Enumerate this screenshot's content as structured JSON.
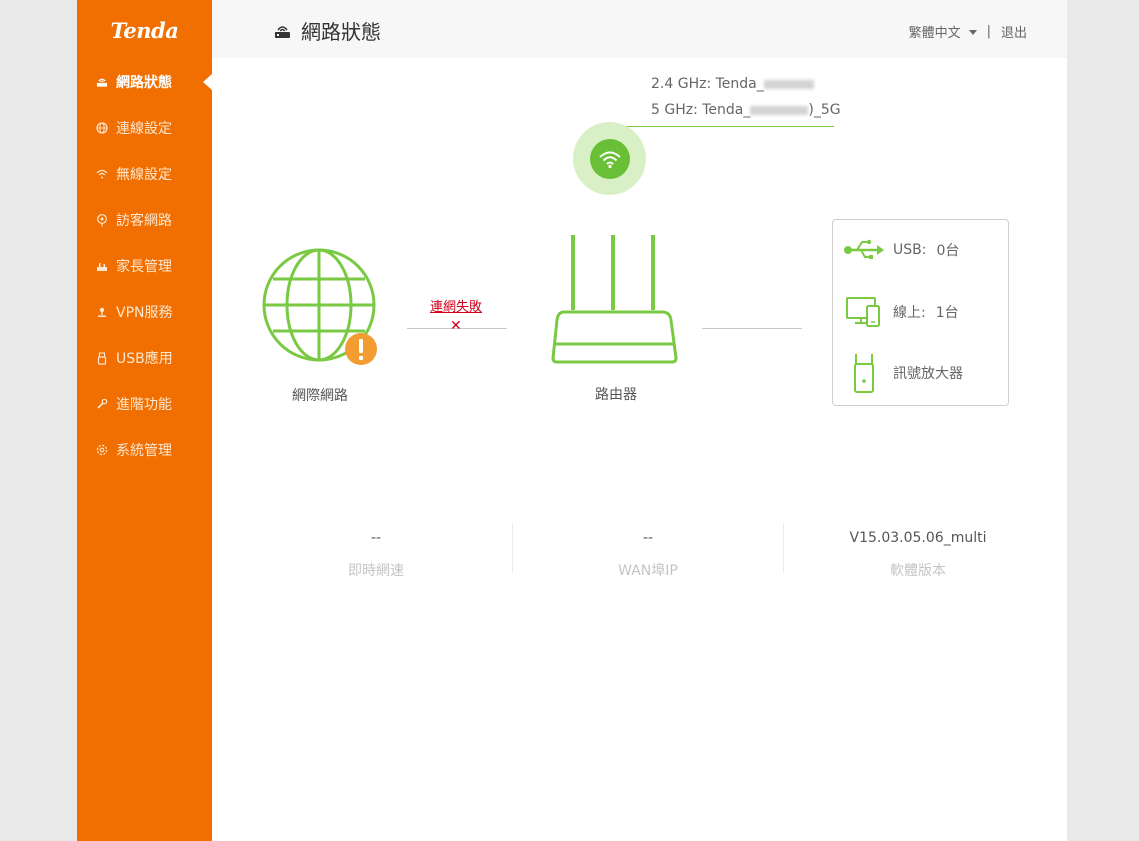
{
  "brand": {
    "logo_text": "Tenda"
  },
  "sidebar": {
    "items": [
      {
        "label": "網路狀態",
        "icon": "router-icon",
        "active": true
      },
      {
        "label": "連線設定",
        "icon": "globe-icon"
      },
      {
        "label": "無線設定",
        "icon": "wifi-icon"
      },
      {
        "label": "訪客網路",
        "icon": "guest-icon"
      },
      {
        "label": "家長管理",
        "icon": "parental-icon"
      },
      {
        "label": "VPN服務",
        "icon": "vpn-icon"
      },
      {
        "label": "USB應用",
        "icon": "usb-icon"
      },
      {
        "label": "進階功能",
        "icon": "wrench-icon"
      },
      {
        "label": "系統管理",
        "icon": "gear-icon"
      }
    ]
  },
  "header": {
    "title": "網路狀態",
    "language": "繁體中文",
    "separator": "|",
    "logout": "退出"
  },
  "wireless": {
    "ssid_24": "2.4 GHz: Tenda_",
    "ssid_5": "5 GHz: Tenda_",
    "ssid_5_suffix": ")_5G"
  },
  "topology": {
    "internet_label": "網際網路",
    "connection_status": "連網失敗",
    "router_label": "路由器"
  },
  "devices": {
    "usb_label": "USB:",
    "usb_value": "0台",
    "online_label": "線上:",
    "online_value": "1台",
    "extender_label": "訊號放大器"
  },
  "stats": {
    "speed_value": "--",
    "speed_label": "即時網速",
    "wan_ip_value": "--",
    "wan_ip_label": "WAN埠IP",
    "firmware_value": "V15.03.05.06_multi",
    "firmware_label": "軟體版本"
  },
  "colors": {
    "sidebar": "#f06f00",
    "accent_green": "#7ac943",
    "error_red": "#d0021b",
    "warning_orange": "#f39c32"
  }
}
